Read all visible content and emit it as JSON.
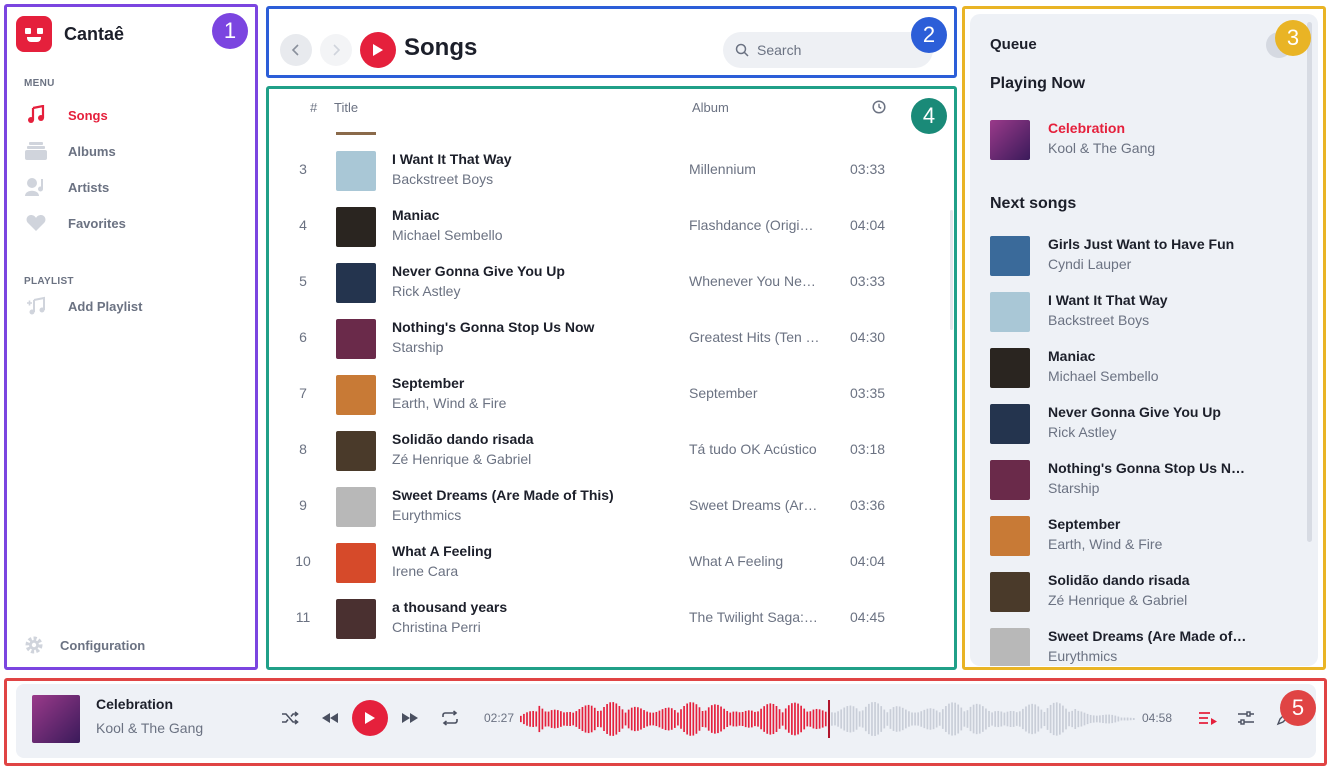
{
  "app": {
    "name": "Cantaê"
  },
  "sidebar": {
    "menu_label": "MENU",
    "items": [
      {
        "label": "Songs",
        "icon": "music-note-icon",
        "active": true
      },
      {
        "label": "Albums",
        "icon": "albums-icon",
        "active": false
      },
      {
        "label": "Artists",
        "icon": "artist-icon",
        "active": false
      },
      {
        "label": "Favorites",
        "icon": "heart-icon",
        "active": false
      }
    ],
    "playlist_label": "PLAYLIST",
    "add_playlist": "Add Playlist",
    "configuration": "Configuration"
  },
  "header": {
    "title": "Songs",
    "search_placeholder": "Search"
  },
  "table": {
    "col_number": "#",
    "col_title": "Title",
    "col_album": "Album",
    "rows": [
      {
        "n": "3",
        "title": "I Want It That Way",
        "artist": "Backstreet Boys",
        "album": "Millennium",
        "duration": "03:33",
        "cover": "#a9c7d6"
      },
      {
        "n": "4",
        "title": "Maniac",
        "artist": "Michael Sembello",
        "album": "Flashdance (Original Soundtrack)",
        "duration": "04:04",
        "cover": "#2a2520"
      },
      {
        "n": "5",
        "title": "Never Gonna Give You Up",
        "artist": "Rick Astley",
        "album": "Whenever You Need Somebody",
        "duration": "03:33",
        "cover": "#24344e"
      },
      {
        "n": "6",
        "title": "Nothing's Gonna Stop Us Now",
        "artist": "Starship",
        "album": "Greatest Hits (Ten Years and Change)",
        "duration": "04:30",
        "cover": "#6a2a4a"
      },
      {
        "n": "7",
        "title": "September",
        "artist": "Earth, Wind & Fire",
        "album": "September",
        "duration": "03:35",
        "cover": "#c87a36"
      },
      {
        "n": "8",
        "title": "Solidão dando risada",
        "artist": "Zé Henrique & Gabriel",
        "album": "Tá tudo OK Acústico",
        "duration": "03:18",
        "cover": "#4a3a2a"
      },
      {
        "n": "9",
        "title": "Sweet Dreams (Are Made of This)",
        "artist": "Eurythmics",
        "album": "Sweet Dreams (Are Made of This)",
        "duration": "03:36",
        "cover": "#b8b8b8"
      },
      {
        "n": "10",
        "title": "What A Feeling",
        "artist": "Irene Cara",
        "album": "What A Feeling",
        "duration": "04:04",
        "cover": "#d64a2a"
      },
      {
        "n": "11",
        "title": "a thousand years",
        "artist": "Christina Perri",
        "album": "The Twilight Saga: Breaking Dawn",
        "duration": "04:45",
        "cover": "#4a3030"
      }
    ]
  },
  "queue": {
    "title": "Queue",
    "playing_now_label": "Playing Now",
    "now": {
      "title": "Celebration",
      "artist": "Kool & The Gang",
      "cover": "#7a2a6a"
    },
    "next_label": "Next songs",
    "next": [
      {
        "title": "Girls Just Want to Have Fun",
        "artist": "Cyndi Lauper",
        "cover": "#3a6a9a"
      },
      {
        "title": "I Want It That Way",
        "artist": "Backstreet Boys",
        "cover": "#a9c7d6"
      },
      {
        "title": "Maniac",
        "artist": "Michael Sembello",
        "cover": "#2a2520"
      },
      {
        "title": "Never Gonna Give You Up",
        "artist": "Rick Astley",
        "cover": "#24344e"
      },
      {
        "title": "Nothing's Gonna Stop Us Now",
        "artist": "Starship",
        "cover": "#6a2a4a"
      },
      {
        "title": "September",
        "artist": "Earth, Wind & Fire",
        "cover": "#c87a36"
      },
      {
        "title": "Solidão dando risada",
        "artist": "Zé Henrique & Gabriel",
        "cover": "#4a3a2a"
      },
      {
        "title": "Sweet Dreams (Are Made of This)",
        "artist": "Eurythmics",
        "cover": "#b8b8b8"
      }
    ]
  },
  "player": {
    "title": "Celebration",
    "artist": "Kool & The Gang",
    "elapsed": "02:27",
    "total": "04:58",
    "progress": 0.5
  },
  "annotations": [
    "1",
    "2",
    "3",
    "4",
    "5"
  ],
  "colors": {
    "accent": "#e5203c",
    "muted": "#6b7282",
    "panel": "#eef1f6"
  }
}
